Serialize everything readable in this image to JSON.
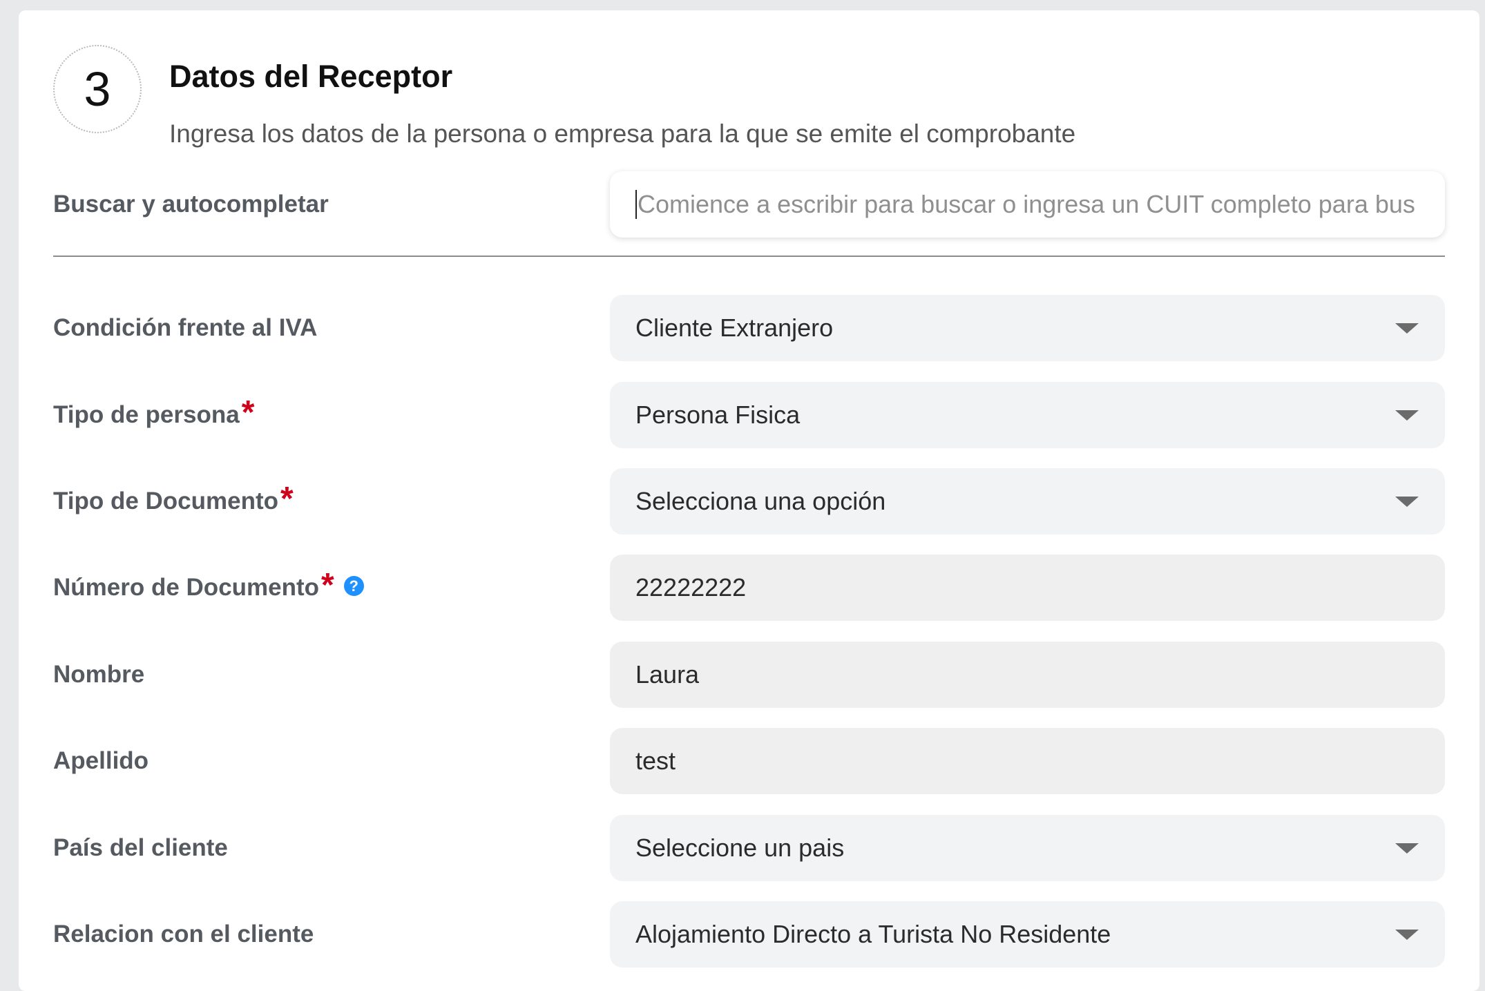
{
  "section": {
    "step_number": "3",
    "title": "Datos del Receptor",
    "subtitle": "Ingresa los datos de la persona o empresa para la que se emite el comprobante"
  },
  "search": {
    "label": "Buscar y autocompletar",
    "placeholder": "Comience a escribir para buscar o ingresa un CUIT completo para bus"
  },
  "fields": {
    "condicion_iva": {
      "label": "Condición frente al IVA",
      "value": "Cliente Extranjero"
    },
    "tipo_persona": {
      "label": "Tipo de persona",
      "value": "Persona Fisica",
      "required_mark": "*"
    },
    "tipo_documento": {
      "label": "Tipo de Documento",
      "value": "Selecciona una opción",
      "required_mark": "*"
    },
    "numero_documento": {
      "label": "Número de Documento",
      "value": "22222222",
      "required_mark": "*",
      "help_glyph": "?"
    },
    "nombre": {
      "label": "Nombre",
      "value": "Laura"
    },
    "apellido": {
      "label": "Apellido",
      "value": "test"
    },
    "pais": {
      "label": "País del cliente",
      "value": "Seleccione un pais"
    },
    "relacion": {
      "label": "Relacion con el cliente",
      "value": "Alojamiento Directo a Turista No Residente"
    }
  },
  "icons": {
    "dropdown": "chevron-down-icon",
    "help": "question-circle-icon"
  },
  "colors": {
    "required": "#d0021b",
    "help": "#1e90ff",
    "label": "#555a60"
  }
}
